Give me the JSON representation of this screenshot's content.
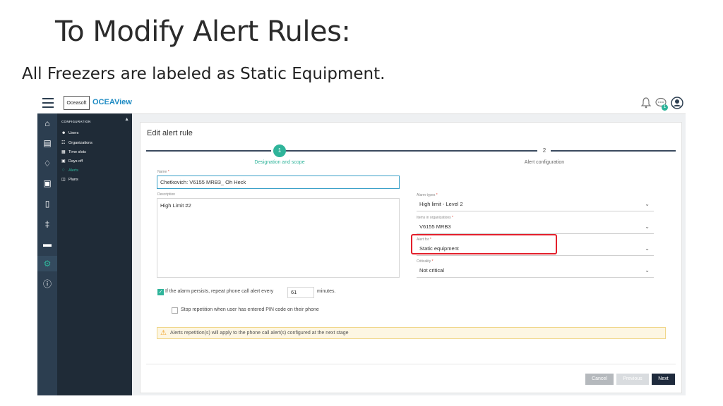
{
  "slide": {
    "title": "To Modify Alert Rules:",
    "subtitle": "All Freezers are labeled as Static Equipment."
  },
  "app": {
    "logo_box": "Oceasoft",
    "logo_text": "OCEAView",
    "notification_badge": "1",
    "sidenav": {
      "header": "CONFIGURATION",
      "items": [
        {
          "label": "Users",
          "icon": "user-icon"
        },
        {
          "label": "Organizations",
          "icon": "sitemap-icon"
        },
        {
          "label": "Time slots",
          "icon": "calendar-icon"
        },
        {
          "label": "Days off",
          "icon": "calendar-off-icon"
        },
        {
          "label": "Alerts",
          "icon": "bell-icon"
        },
        {
          "label": "Plans",
          "icon": "map-icon"
        }
      ]
    },
    "iconbar": [
      "home-icon",
      "document-icon",
      "bell-icon",
      "report-icon",
      "sensor-icon",
      "thermometer-icon",
      "device-icon",
      "settings-icon",
      "help-icon"
    ]
  },
  "form": {
    "title": "Edit alert rule",
    "steps": [
      {
        "number": "1",
        "label": "Designation and scope"
      },
      {
        "number": "2",
        "label": "Alert configuration"
      }
    ],
    "name_label": "Name",
    "name_value": "Chetkovich: V6155 MRB3_ Oh Heck",
    "description_label": "Description",
    "description_value": "High Limit #2",
    "alarm_types_label": "Alarm types",
    "alarm_types_value": "High limit - Level 2",
    "items_label": "Items in organizations",
    "items_value": "V6155 MRB3",
    "alert_for_label": "Alert for",
    "alert_for_value": "Static equipment",
    "criticality_label": "Criticality",
    "criticality_value": "Not critical",
    "repeat_prefix": "If the alarm persists, repeat phone call alert every",
    "repeat_value": "61",
    "repeat_suffix": "minutes.",
    "stop_repeat_label": "Stop repetition when user has entered PIN code on their phone",
    "warning_text": "Alerts repetition(s) will apply to the phone call alert(s) configured at the next stage",
    "buttons": {
      "cancel": "Cancel",
      "previous": "Previous",
      "next": "Next"
    }
  },
  "colors": {
    "accent": "#2fb49a",
    "nav_dark": "#2c3e50",
    "highlight_red": "#e3202c",
    "next_button": "#1f2b3d"
  }
}
